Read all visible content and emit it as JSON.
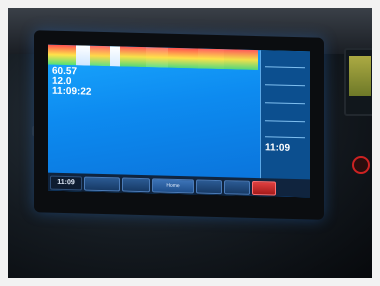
{
  "readouts": {
    "line1": "60.57",
    "line2": "12.0",
    "line3": "11:09:22"
  },
  "sidebar": {
    "value": "11:09"
  },
  "bottom_bar": {
    "clock": "11:09",
    "home": "Home"
  },
  "colors": {
    "screen_blue": "#0d8bf0",
    "sidebar_blue": "#0c4f8f",
    "alert_red": "#d32f2f"
  },
  "icons": {
    "status_knob": "red-ring-knob-icon"
  }
}
